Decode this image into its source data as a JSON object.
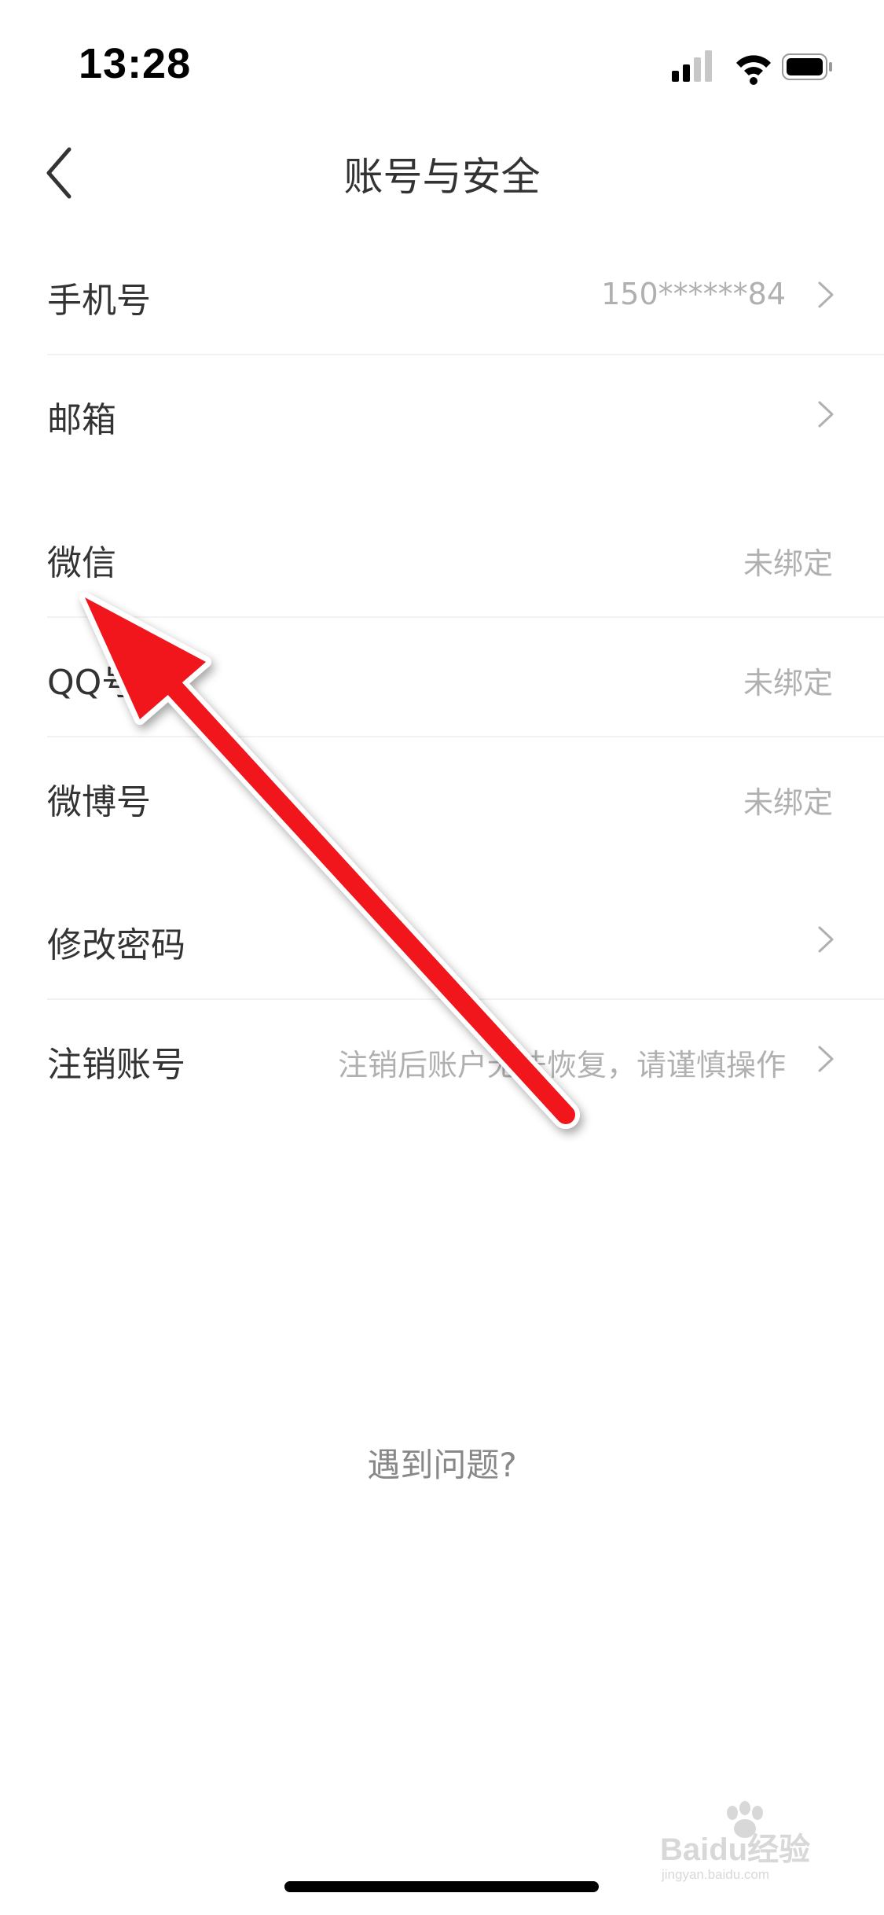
{
  "status_bar": {
    "time": "13:28",
    "signal_icon": "signal-bars-icon",
    "wifi_icon": "wifi-icon",
    "battery_icon": "battery-icon"
  },
  "nav": {
    "title": "账号与安全",
    "back_icon": "chevron-left-icon"
  },
  "list": {
    "phone": {
      "label": "手机号",
      "value": "150******84"
    },
    "email": {
      "label": "邮箱",
      "value": ""
    },
    "wechat": {
      "label": "微信",
      "value": "未绑定"
    },
    "qq": {
      "label": "QQ号",
      "value": "未绑定"
    },
    "weibo": {
      "label": "微博号",
      "value": "未绑定"
    },
    "change_password": {
      "label": "修改密码",
      "value": ""
    },
    "cancel_account": {
      "label": "注销账号",
      "value": "注销后账户无法恢复，请谨慎操作"
    }
  },
  "help_link": "遇到问题?",
  "colors": {
    "text_primary": "#333333",
    "text_secondary": "#b0b0b0",
    "annotation_arrow": "#f0141e"
  },
  "watermark": {
    "brand": "Baidu经验",
    "url": "jingyan.baidu.com"
  }
}
